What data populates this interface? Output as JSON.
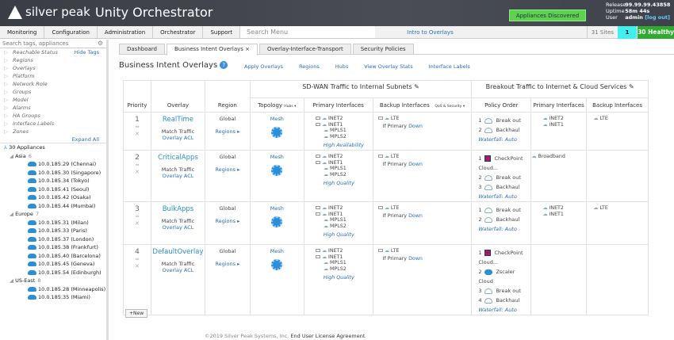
{
  "header": {
    "brand": "silver peak",
    "title": "Unity Orchestrator",
    "alert": "Appliances Discovered",
    "release_label": "Release",
    "release": "99.99.99.43858",
    "uptime_label": "Uptime",
    "uptime": "58m 44s",
    "user_label": "User",
    "user": "admin",
    "logout": "[log out]"
  },
  "menu": {
    "items": [
      "Monitoring",
      "Configuration",
      "Administration",
      "Orchestrator",
      "Support"
    ],
    "search_placeholder": "Search Menu",
    "intro": "Intro to Overlays",
    "sites": "31 Sites",
    "alarm_count": "1",
    "healthy": "30 Healthy"
  },
  "sidebar": {
    "search_placeholder": "Search tags, appliances",
    "hide_tags": "Hide Tags",
    "expand_all": "Expand All",
    "tags": [
      "Reachable Status",
      "Regions",
      "Overlays",
      "Platform",
      "Network Role",
      "Groups",
      "Model",
      "Alarms",
      "HA Groups",
      "Interface Labels",
      "Zones"
    ],
    "root": "30 Appliances",
    "groups": [
      {
        "name": "Asia",
        "count": "6",
        "apps": [
          "10.0.185.29 (Chennai)",
          "10.0.185.30 (Singapore)",
          "10.0.185.34 (Tokyo)",
          "10.0.185.41 (Seoul)",
          "10.0.185.42 (Osaka)",
          "10.0.185.44 (Mumbai)"
        ]
      },
      {
        "name": "Europe",
        "count": "7",
        "apps": [
          "10.0.185.31 (Milan)",
          "10.0.185.33 (Paris)",
          "10.0.185.37 (London)",
          "10.0.185.38 (Frankfurt)",
          "10.0.185.40 (Barcelona)",
          "10.0.185.45 (Geneva)",
          "10.0.185.54 (Edinburgh)"
        ]
      },
      {
        "name": "US-East",
        "count": "8",
        "apps": [
          "10.0.185.28 (Minneapolis)",
          "10.0.185.35 (Miami)"
        ]
      }
    ]
  },
  "tabs": [
    "Dashboard",
    "Business Intent Overlays ×",
    "Overlay-Interface-Transport",
    "Security Policies"
  ],
  "page": {
    "title": "Business Intent Overlays",
    "help": "?",
    "links": [
      "Apply Overlays",
      "Regions",
      "Hubs",
      "View Overlay Stats",
      "Interface Labels"
    ],
    "new_button": "+New"
  },
  "table": {
    "group_sdwan": "SD-WAN Traffic to Internal Subnets ✎",
    "group_breakout": "Breakout Traffic to Internet & Cloud Services ✎",
    "cols": [
      "Priority",
      "Overlay",
      "Region",
      "Topology",
      "Hubs ▾",
      "Primary Interfaces",
      "Backup Interfaces",
      "QoS & Security ▾",
      "Policy Order",
      "Primary Interfaces",
      "Backup Interfaces"
    ],
    "match_traffic": "Match Traffic",
    "overlay_acl": "Overlay ACL",
    "regions_link": "Regions ▸",
    "if_primary": "If Primary",
    "down": "Down",
    "rows": [
      {
        "priority": "1",
        "name": "RealTime",
        "region": "Global",
        "topology": "Mesh",
        "primary": [
          "INET2",
          "INET1",
          "MPLS1",
          "MPLS2"
        ],
        "backup": [
          "LTE"
        ],
        "quality": "High Availability",
        "policy": [
          {
            "n": "1",
            "type": "cloud",
            "label": "Break out"
          },
          {
            "n": "2",
            "type": "cloud",
            "label": "Backhaul"
          }
        ],
        "waterfall": "Waterfall: Auto",
        "bprimary": [
          "INET2",
          "INET1"
        ],
        "bbackup": [
          "LTE"
        ]
      },
      {
        "priority": "2",
        "name": "CriticalApps",
        "region": "Global",
        "topology": "Mesh",
        "primary": [
          "INET2",
          "INET1",
          "MPLS1",
          "MPLS2"
        ],
        "backup": [
          "LTE"
        ],
        "quality": "High Quality",
        "policy": [
          {
            "n": "1",
            "type": "cp",
            "label": "CheckPoint Cloud..."
          },
          {
            "n": "2",
            "type": "cloud",
            "label": "Break out"
          },
          {
            "n": "3",
            "type": "cloud",
            "label": "Backhaul"
          }
        ],
        "waterfall": "Waterfall: Auto",
        "bprimary": [
          "Broadband"
        ],
        "bbackup": []
      },
      {
        "priority": "3",
        "name": "BulkApps",
        "region": "Global",
        "topology": "Mesh",
        "primary": [
          "INET2",
          "INET1",
          "MPLS1",
          "MPLS2"
        ],
        "backup": [
          "LTE"
        ],
        "quality": "High Quality",
        "policy": [
          {
            "n": "1",
            "type": "cloud",
            "label": "Break out"
          },
          {
            "n": "2",
            "type": "cloud",
            "label": "Backhaul"
          }
        ],
        "waterfall": "Waterfall: Auto",
        "bprimary": [
          "INET2",
          "INET1"
        ],
        "bbackup": [
          "LTE"
        ]
      },
      {
        "priority": "4",
        "name": "DefaultOverlay",
        "region": "Global",
        "topology": "Mesh",
        "primary": [
          "INET2",
          "INET1",
          "MPLS1",
          "MPLS2"
        ],
        "backup": [
          "LTE"
        ],
        "quality": "High Quality",
        "policy": [
          {
            "n": "1",
            "type": "cp",
            "label": "CheckPoint Cloud..."
          },
          {
            "n": "2",
            "type": "zs",
            "label": "Zscaler Cloud"
          },
          {
            "n": "3",
            "type": "cloud",
            "label": "Break out"
          },
          {
            "n": "4",
            "type": "cloud",
            "label": "Backhaul"
          }
        ],
        "waterfall": "Waterfall: Auto",
        "bprimary": [],
        "bbackup": []
      }
    ]
  },
  "footer": {
    "copyright": "©2019 Silver Peak Systems, Inc.",
    "eula": "End User License Agreement"
  }
}
